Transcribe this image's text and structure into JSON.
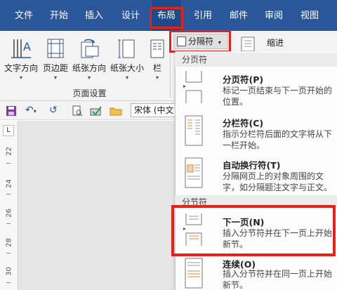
{
  "tabs": [
    {
      "label": "文件"
    },
    {
      "label": "开始"
    },
    {
      "label": "插入"
    },
    {
      "label": "设计"
    },
    {
      "label": "布局"
    },
    {
      "label": "引用"
    },
    {
      "label": "邮件"
    },
    {
      "label": "审阅"
    },
    {
      "label": "视图"
    }
  ],
  "ribbon": {
    "buttons": [
      {
        "label": "文字方向",
        "icon": "text-direction-icon"
      },
      {
        "label": "页边距",
        "icon": "margins-icon"
      },
      {
        "label": "纸张方向",
        "icon": "orientation-icon"
      },
      {
        "label": "纸张大小",
        "icon": "paper-size-icon"
      },
      {
        "label": "栏",
        "icon": "columns-icon"
      }
    ],
    "group_label": "页面设置",
    "breaks_button": "分隔符",
    "indent_label": "缩进"
  },
  "qat": {
    "font_value": "宋体 (中文"
  },
  "ruler": {
    "corner": "L",
    "numbers": [
      "22",
      "24",
      "26",
      "28",
      "30"
    ]
  },
  "menu": {
    "page_breaks_header": "分页符",
    "section_breaks_header": "分节符",
    "items": [
      {
        "title": "分页符(P)",
        "desc": "标记一页结束与下一页开始的位置。"
      },
      {
        "title": "分栏符(C)",
        "desc": "指示分栏符后面的文字将从下一栏开始。"
      },
      {
        "title": "自动换行符(T)",
        "desc": "分隔网页上的对象周围的文字，如分隔题注文字与正文。"
      },
      {
        "title": "下一页(N)",
        "desc": "插入分节符并在下一页上开始新节。"
      },
      {
        "title": "连续(O)",
        "desc": "插入分节符并在同一页上开始新节。"
      }
    ]
  },
  "colors": {
    "tab_bar": "#2b579a",
    "highlight": "#e2231a",
    "accent_blue": "#2b579a"
  }
}
